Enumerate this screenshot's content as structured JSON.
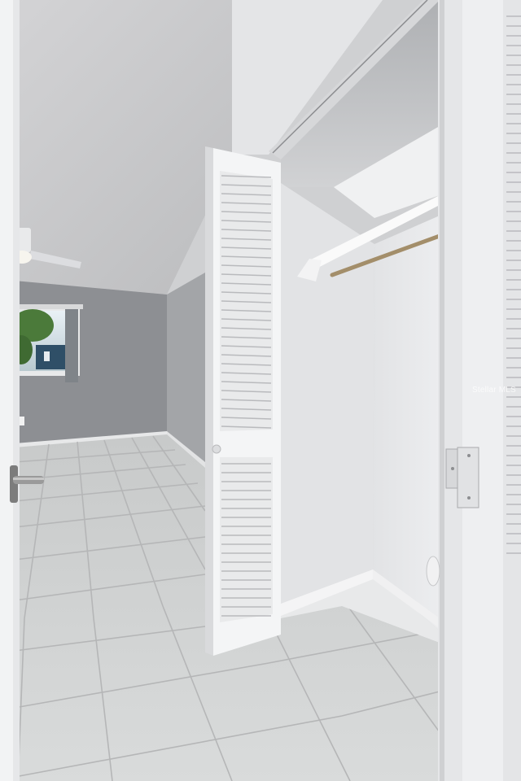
{
  "scene": {
    "description_free": true,
    "watermark": "Stellar MLS",
    "colors": {
      "ceiling": "#c9c9cb",
      "back_wall": "#8d8f93",
      "side_wall": "#a3a5a8",
      "floor": "#d2d4d4",
      "grout": "#b7b8b8",
      "door_white": "#f4f5f6",
      "closet_wall": "#e6e7e9",
      "rod": "#a38e6a"
    }
  }
}
